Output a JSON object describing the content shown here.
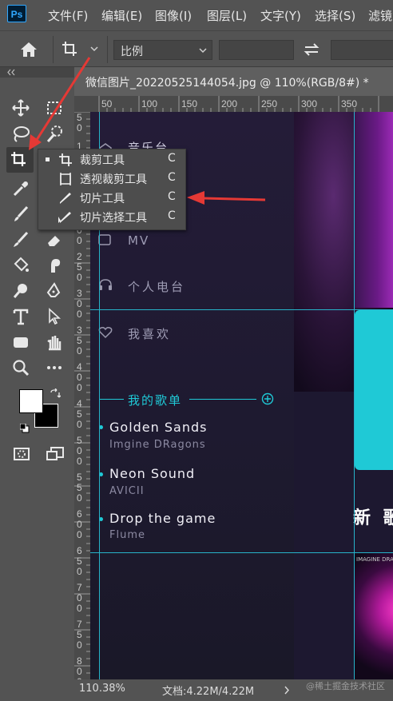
{
  "app": {
    "logo": "Ps"
  },
  "menubar": {
    "items": [
      "文件(F)",
      "编辑(E)",
      "图像(I)",
      "图层(L)",
      "文字(Y)",
      "选择(S)",
      "滤镜"
    ]
  },
  "options": {
    "ratio_label": "比例",
    "swap_icon": "swap-icon"
  },
  "document": {
    "tab_title": "微信图片_20220525144054.jpg @ 110%(RGB/8#) *",
    "ruler_top": [
      "50",
      "100",
      "150",
      "200",
      "250",
      "300",
      "350"
    ],
    "ruler_left": [
      [
        "5",
        "0"
      ],
      [
        "1",
        "0",
        "0"
      ],
      [
        "1",
        "5",
        "0"
      ],
      [
        "2",
        "0",
        "0"
      ],
      [
        "2",
        "5",
        "0"
      ],
      [
        "3",
        "0",
        "0"
      ],
      [
        "3",
        "5",
        "0"
      ],
      [
        "4",
        "0",
        "0"
      ],
      [
        "4",
        "5",
        "0"
      ],
      [
        "5",
        "0",
        "0"
      ],
      [
        "5",
        "5",
        "0"
      ],
      [
        "6",
        "0",
        "0"
      ],
      [
        "6",
        "5",
        "0"
      ],
      [
        "7",
        "0",
        "0"
      ],
      [
        "7",
        "5",
        "0"
      ],
      [
        "8",
        "0",
        "0"
      ]
    ]
  },
  "flyout": {
    "items": [
      {
        "label": "裁剪工具",
        "shortcut": "C",
        "icon": "crop-icon",
        "active": true
      },
      {
        "label": "透视裁剪工具",
        "shortcut": "C",
        "icon": "perspective-crop-icon",
        "active": false
      },
      {
        "label": "切片工具",
        "shortcut": "C",
        "icon": "slice-icon",
        "active": false
      },
      {
        "label": "切片选择工具",
        "shortcut": "C",
        "icon": "slice-select-icon",
        "active": false
      }
    ]
  },
  "canvas_content": {
    "nav_top_partial": "音乐台",
    "nav_items": [
      {
        "label": "MV",
        "icon": "video-icon"
      },
      {
        "label": "个人电台",
        "icon": "headphones-icon"
      },
      {
        "label": "我喜欢",
        "icon": "heart-icon"
      }
    ],
    "section_title": "我的歌单",
    "songs": [
      {
        "title": "Golden Sands",
        "artist": "Imgine DRagons"
      },
      {
        "title": "Neon Sound",
        "artist": "AVICII"
      },
      {
        "title": "Drop the game",
        "artist": "Flume"
      }
    ],
    "heading_partial": "新 歌",
    "album_caption": "IMAGINE DRAGONS"
  },
  "status": {
    "zoom": "110.38%",
    "doc_info": "文档:4.22M/4.22M",
    "watermark": "@稀土掘金技术社区"
  },
  "colors": {
    "accent_cyan": "#1fc9d6",
    "guide": "#27b3c9",
    "annotation_red": "#e53935"
  }
}
